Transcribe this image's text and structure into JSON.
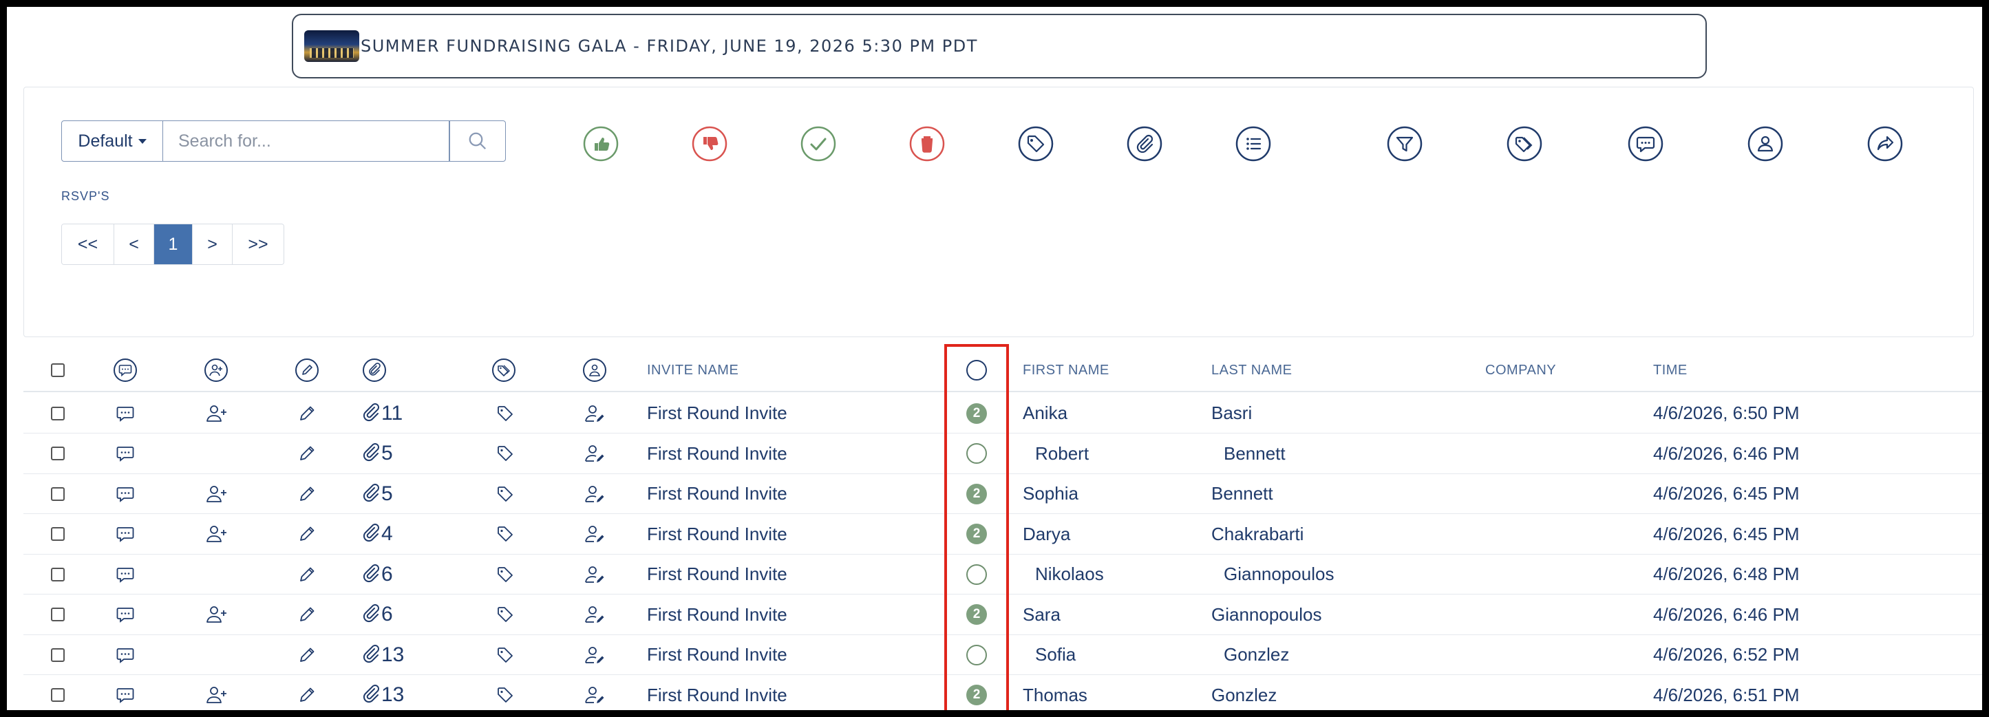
{
  "event": {
    "title": "SUMMER FUNDRAISING GALA - FRIDAY, JUNE 19, 2026 5:30 PM PDT"
  },
  "toolbar": {
    "view_select": "Default",
    "search_placeholder": "Search for...",
    "icons": [
      {
        "name": "thumbs-up-icon",
        "color": "#6a9a6a"
      },
      {
        "name": "thumbs-down-icon",
        "color": "#d9534f"
      },
      {
        "name": "checkmark-icon",
        "color": "#6a9a6a"
      },
      {
        "name": "trash-icon",
        "color": "#d9534f"
      },
      {
        "name": "tag-icon",
        "color": "#1f3a6a"
      },
      {
        "name": "paperclip-icon",
        "color": "#1f3a6a"
      },
      {
        "name": "list-icon",
        "color": "#1f3a6a"
      },
      {
        "name": "filter-icon",
        "color": "#1f3a6a"
      },
      {
        "name": "tags-icon",
        "color": "#1f3a6a"
      },
      {
        "name": "message-icon",
        "color": "#1f3a6a"
      },
      {
        "name": "user-icon",
        "color": "#1f3a6a"
      },
      {
        "name": "share-icon",
        "color": "#1f3a6a"
      }
    ]
  },
  "section_label": "RSVP'S",
  "pagination": {
    "first": "<<",
    "prev": "<",
    "current": "1",
    "next": ">",
    "last": ">>"
  },
  "table": {
    "headers": {
      "invite_name": "INVITE NAME",
      "first_name": "FIRST NAME",
      "last_name": "LAST NAME",
      "company": "COMPANY",
      "time": "TIME"
    },
    "rows": [
      {
        "has_add_user": true,
        "attachments": "11",
        "invite": "First Round Invite",
        "status": "2",
        "first": "Anika",
        "last": "Basri",
        "company": "",
        "time": "4/6/2026, 6:50 PM"
      },
      {
        "has_add_user": false,
        "attachments": "5",
        "invite": "First Round Invite",
        "status": "",
        "first": "Robert",
        "last": "Bennett",
        "company": "",
        "time": "4/6/2026, 6:46 PM"
      },
      {
        "has_add_user": true,
        "attachments": "5",
        "invite": "First Round Invite",
        "status": "2",
        "first": "Sophia",
        "last": "Bennett",
        "company": "",
        "time": "4/6/2026, 6:45 PM"
      },
      {
        "has_add_user": true,
        "attachments": "4",
        "invite": "First Round Invite",
        "status": "2",
        "first": "Darya",
        "last": "Chakrabarti",
        "company": "",
        "time": "4/6/2026, 6:45 PM"
      },
      {
        "has_add_user": false,
        "attachments": "6",
        "invite": "First Round Invite",
        "status": "",
        "first": "Nikolaos",
        "last": "Giannopoulos",
        "company": "",
        "time": "4/6/2026, 6:48 PM"
      },
      {
        "has_add_user": true,
        "attachments": "6",
        "invite": "First Round Invite",
        "status": "2",
        "first": "Sara",
        "last": "Giannopoulos",
        "company": "",
        "time": "4/6/2026, 6:46 PM"
      },
      {
        "has_add_user": false,
        "attachments": "13",
        "invite": "First Round Invite",
        "status": "",
        "first": "Sofia",
        "last": "Gonzlez",
        "company": "",
        "time": "4/6/2026, 6:52 PM"
      },
      {
        "has_add_user": true,
        "attachments": "13",
        "invite": "First Round Invite",
        "status": "2",
        "first": "Thomas",
        "last": "Gonzlez",
        "company": "",
        "time": "4/6/2026, 6:51 PM"
      }
    ]
  },
  "colors": {
    "primary": "#1f3a6a",
    "active_page": "#4471ad",
    "status_badge": "#7fa07f",
    "highlight": "#e0251b"
  }
}
